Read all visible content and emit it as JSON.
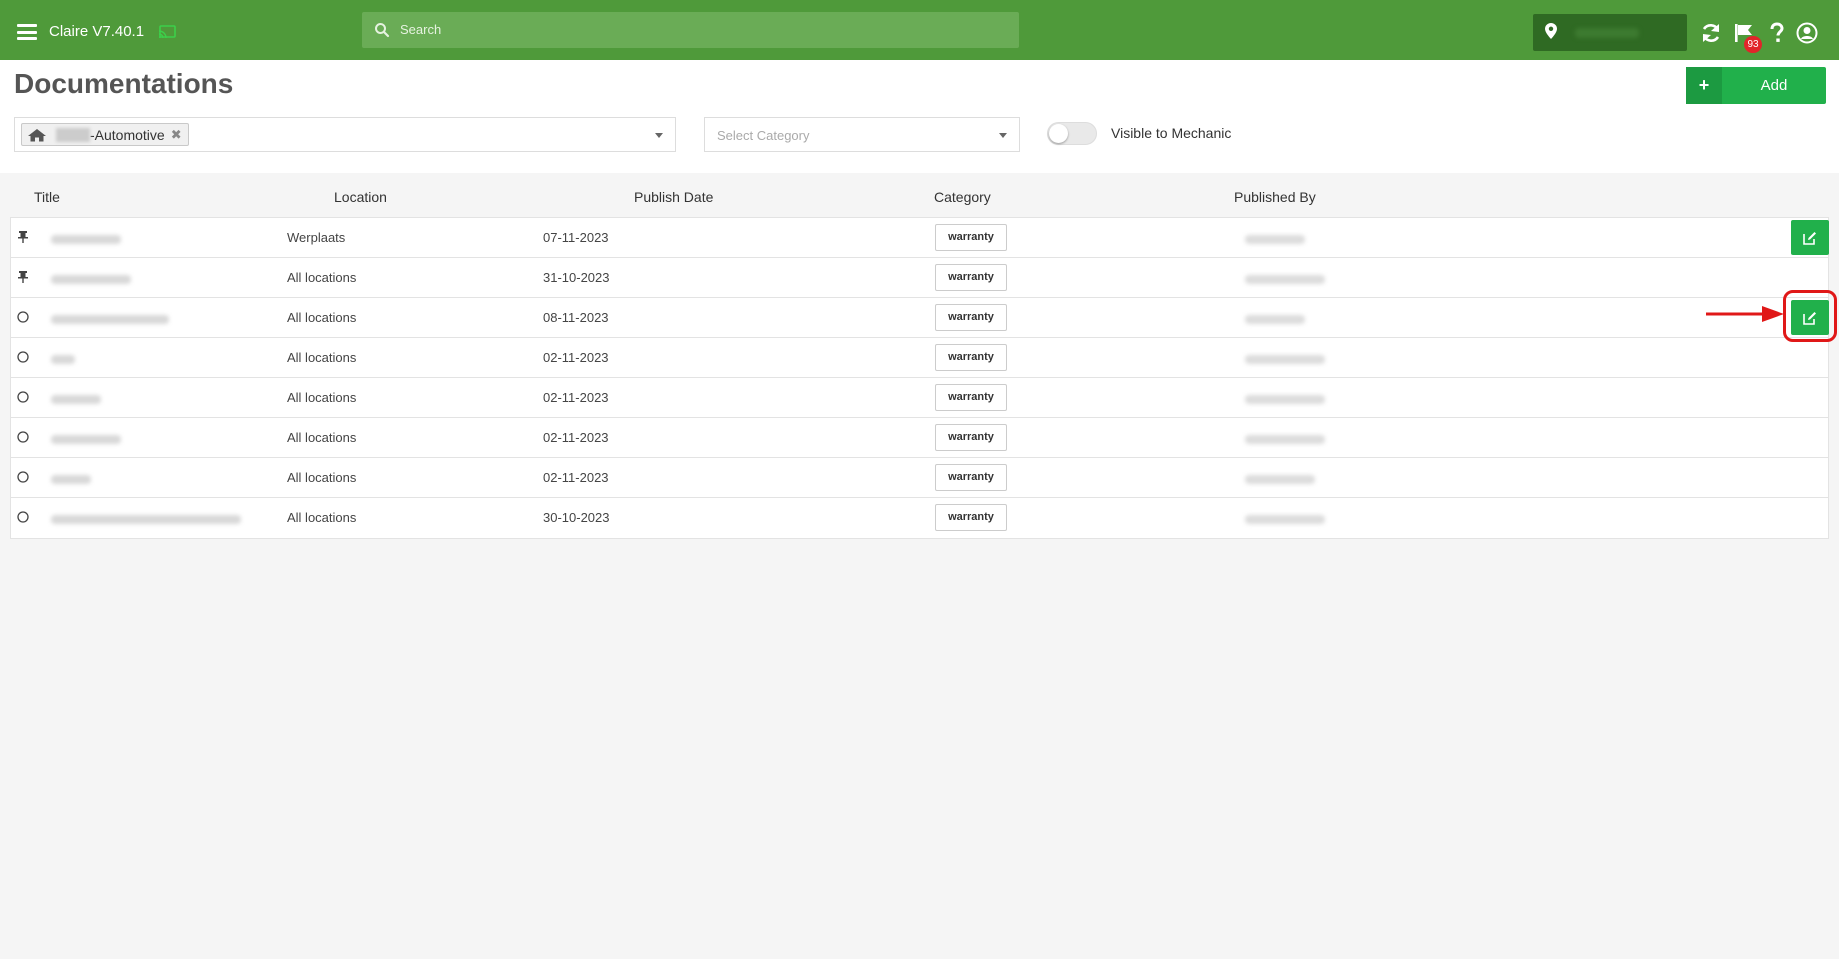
{
  "app": {
    "title": "Claire V7.40.1",
    "badge_count": "93",
    "accent_color": "#4f9a3a",
    "button_color": "#21b04b"
  },
  "search": {
    "placeholder": "Search"
  },
  "page": {
    "title": "Documentations",
    "add_label": "Add"
  },
  "filters": {
    "location_chip": "-Automotive",
    "category_placeholder": "Select Category",
    "visible_to_mechanic_label": "Visible to Mechanic",
    "visible_to_mechanic_on": false
  },
  "table": {
    "columns": [
      "Title",
      "Location",
      "Publish Date",
      "Category",
      "Published By"
    ],
    "rows": [
      {
        "icon": "pin-icon",
        "location": "Werplaats",
        "publish_date": "07-11-2023",
        "category": "warranty",
        "edit": true
      },
      {
        "icon": "pin-icon",
        "location": "All locations",
        "publish_date": "31-10-2023",
        "category": "warranty",
        "edit": false
      },
      {
        "icon": "circle-icon",
        "location": "All locations",
        "publish_date": "08-11-2023",
        "category": "warranty",
        "edit": true
      },
      {
        "icon": "circle-icon",
        "location": "All locations",
        "publish_date": "02-11-2023",
        "category": "warranty",
        "edit": false
      },
      {
        "icon": "circle-icon",
        "location": "All locations",
        "publish_date": "02-11-2023",
        "category": "warranty",
        "edit": false
      },
      {
        "icon": "circle-icon",
        "location": "All locations",
        "publish_date": "02-11-2023",
        "category": "warranty",
        "edit": false
      },
      {
        "icon": "circle-icon",
        "location": "All locations",
        "publish_date": "02-11-2023",
        "category": "warranty",
        "edit": false
      },
      {
        "icon": "circle-icon",
        "location": "All locations",
        "publish_date": "30-10-2023",
        "category": "warranty",
        "edit": false
      }
    ]
  },
  "icons": [
    "menu-icon",
    "cast-icon",
    "search-icon",
    "location-pin-icon",
    "refresh-icon",
    "flag-icon",
    "help-icon",
    "user-icon",
    "home-icon",
    "plus-icon",
    "edit-icon",
    "pin-icon",
    "circle-icon"
  ]
}
